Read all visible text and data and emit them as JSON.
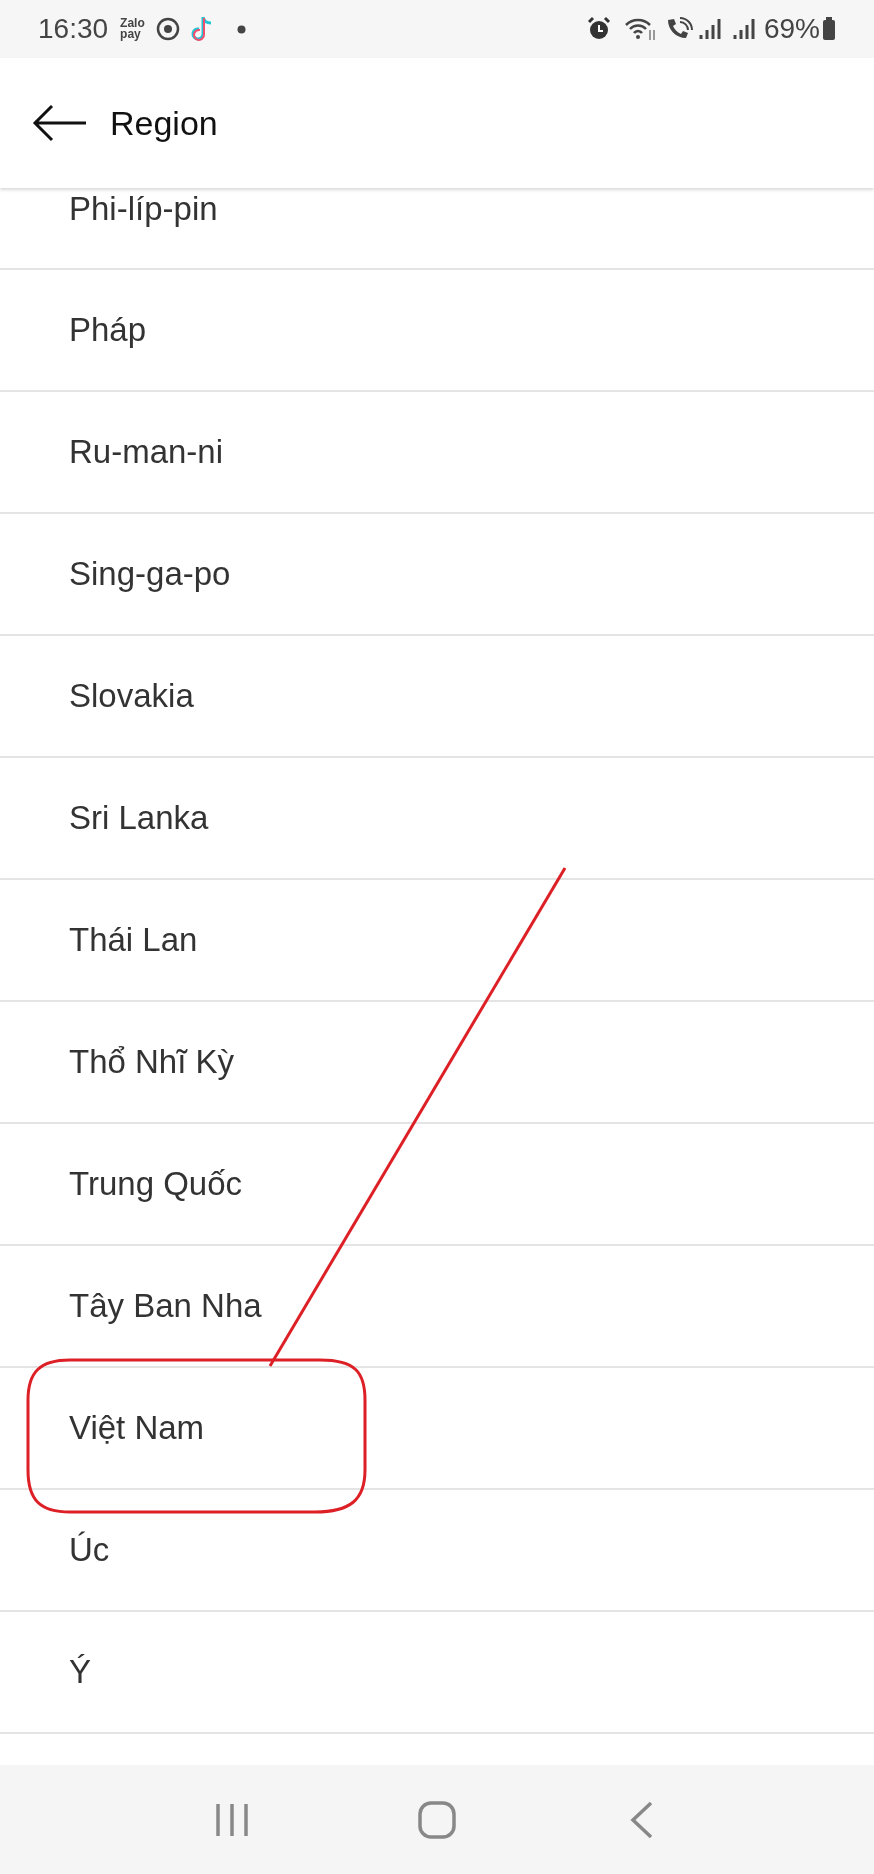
{
  "status_bar": {
    "time": "16:30",
    "zalo_label": [
      "Zalo",
      "pay"
    ],
    "battery": "69%"
  },
  "header": {
    "title": "Region"
  },
  "regions": [
    {
      "label": "Phi-líp-pin"
    },
    {
      "label": "Pháp"
    },
    {
      "label": "Ru-man-ni"
    },
    {
      "label": "Sing-ga-po"
    },
    {
      "label": "Slovakia"
    },
    {
      "label": "Sri Lanka"
    },
    {
      "label": "Thái Lan"
    },
    {
      "label": "Thổ Nhĩ Kỳ"
    },
    {
      "label": "Trung Quốc"
    },
    {
      "label": "Tây Ban Nha"
    },
    {
      "label": "Việt Nam"
    },
    {
      "label": "Úc"
    },
    {
      "label": "Ý"
    }
  ]
}
